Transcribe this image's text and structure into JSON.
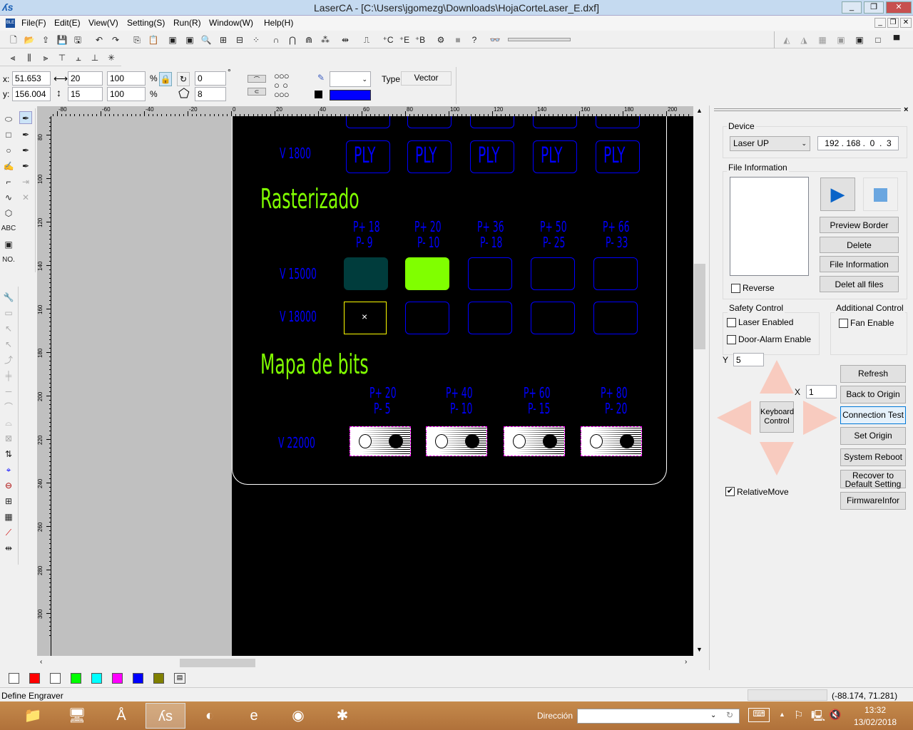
{
  "window": {
    "title": "LaserCA - [C:\\Users\\jgomezg\\Downloads\\HojaCorteLaser_E.dxf]",
    "app_icon": "laserca-logo",
    "buttons": [
      "minimize",
      "restore",
      "close"
    ]
  },
  "menu": [
    "File(F)",
    "Edit(E)",
    "View(V)",
    "Setting(S)",
    "Run(R)",
    "Window(W)",
    "Help(H)"
  ],
  "toolbar_main": [
    "new-file",
    "open-folder",
    "import",
    "save",
    "save-as",
    "undo",
    "redo",
    "copy",
    "paste",
    "view-monitor",
    "view-monitor-2",
    "zoom",
    "group",
    "ungroup",
    "array",
    "weld",
    "mirror-h",
    "mirror-v",
    "combine",
    "distribute",
    "path",
    "add-c",
    "add-e",
    "add-b",
    "laser-settings",
    "fill-gray",
    "help",
    "binoculars"
  ],
  "toolbar_align": [
    "align-left",
    "align-center-v",
    "align-right",
    "align-top",
    "align-center-h",
    "align-bottom",
    "align-center"
  ],
  "props": {
    "x_label": "x:",
    "y_label": "y:",
    "x": "51.653",
    "y": "156.004",
    "width": "20",
    "height": "15",
    "scale_w": "100",
    "scale_h": "100",
    "percent": "%",
    "rotation": "0",
    "degree": "°",
    "polygon_sides": "8",
    "type_label": "Type",
    "type_value": "Vector",
    "color": "#0000ff"
  },
  "ruler": {
    "h_labels": [
      "-80",
      "-60",
      "-40",
      "-20",
      "0",
      "20",
      "40",
      "60",
      "80",
      "100",
      "120",
      "140",
      "160",
      "180",
      "200"
    ],
    "v_labels": [
      "80",
      "100",
      "120",
      "140",
      "160",
      "180",
      "200",
      "220",
      "240",
      "260",
      "280",
      "300"
    ]
  },
  "canvas": {
    "row_v1800": "V 1800",
    "ply": "PLY",
    "raster_title": "Rasterizado",
    "raster_params": [
      [
        "P+ 18",
        "P- 9"
      ],
      [
        "P+ 20",
        "P- 10"
      ],
      [
        "P+ 36",
        "P- 18"
      ],
      [
        "P+ 50",
        "P- 25"
      ],
      [
        "P+ 66",
        "P- 33"
      ]
    ],
    "row_v15000": "V 15000",
    "row_v18000": "V 18000",
    "bitmap_title": "Mapa de bits",
    "bitmap_params": [
      [
        "P+ 20",
        "P- 5"
      ],
      [
        "P+ 40",
        "P- 10"
      ],
      [
        "P+ 60",
        "P- 15"
      ],
      [
        "P+ 80",
        "P- 20"
      ]
    ],
    "row_v22000": "V 22000",
    "fill_colors": [
      "#003c3c",
      "#80ff00"
    ]
  },
  "palette": [
    "#ffffff",
    "#ff0000",
    "#ffffff",
    "#00ff00",
    "#00ffff",
    "#ff00ff",
    "#0000ff",
    "#808000"
  ],
  "panel": {
    "device_label": "Device",
    "device_value": "Laser UP",
    "ip": "192 . 168 .  0  .  3",
    "file_info_label": "File Information",
    "reverse": "Reverse",
    "preview_border": "Preview Border",
    "delete": "Delete",
    "file_information": "File Information",
    "delete_all": "Delet all files",
    "safety_label": "Safety Control",
    "laser_enabled": "Laser Enabled",
    "door_alarm": "Door-Alarm Enable",
    "additional_label": "Additional Control",
    "fan_enable": "Fan Enable",
    "y_label": "Y",
    "y_value": "5",
    "x_label": "X",
    "x_value": "1",
    "keyboard_control": "Keyboard Control",
    "relative_move": "RelativeMove",
    "relative_move_checked": true,
    "buttons": [
      "Refresh",
      "Back to Origin",
      "Connection Test",
      "Set Origin",
      "System Reboot",
      "Recover to Default Setting",
      "FirmwareInfor"
    ]
  },
  "status": {
    "left": "Define Engraver",
    "coords": "(-88.174, 71.281)"
  },
  "taskbar": {
    "apps": [
      "file-explorer",
      "device-manager",
      "adobe-illustrator",
      "laserca",
      "3d-app",
      "internet-explorer",
      "chrome",
      "bluetooth-app"
    ],
    "address_label": "Dirección",
    "address_value": "",
    "time": "13:32",
    "date": "13/02/2018"
  }
}
